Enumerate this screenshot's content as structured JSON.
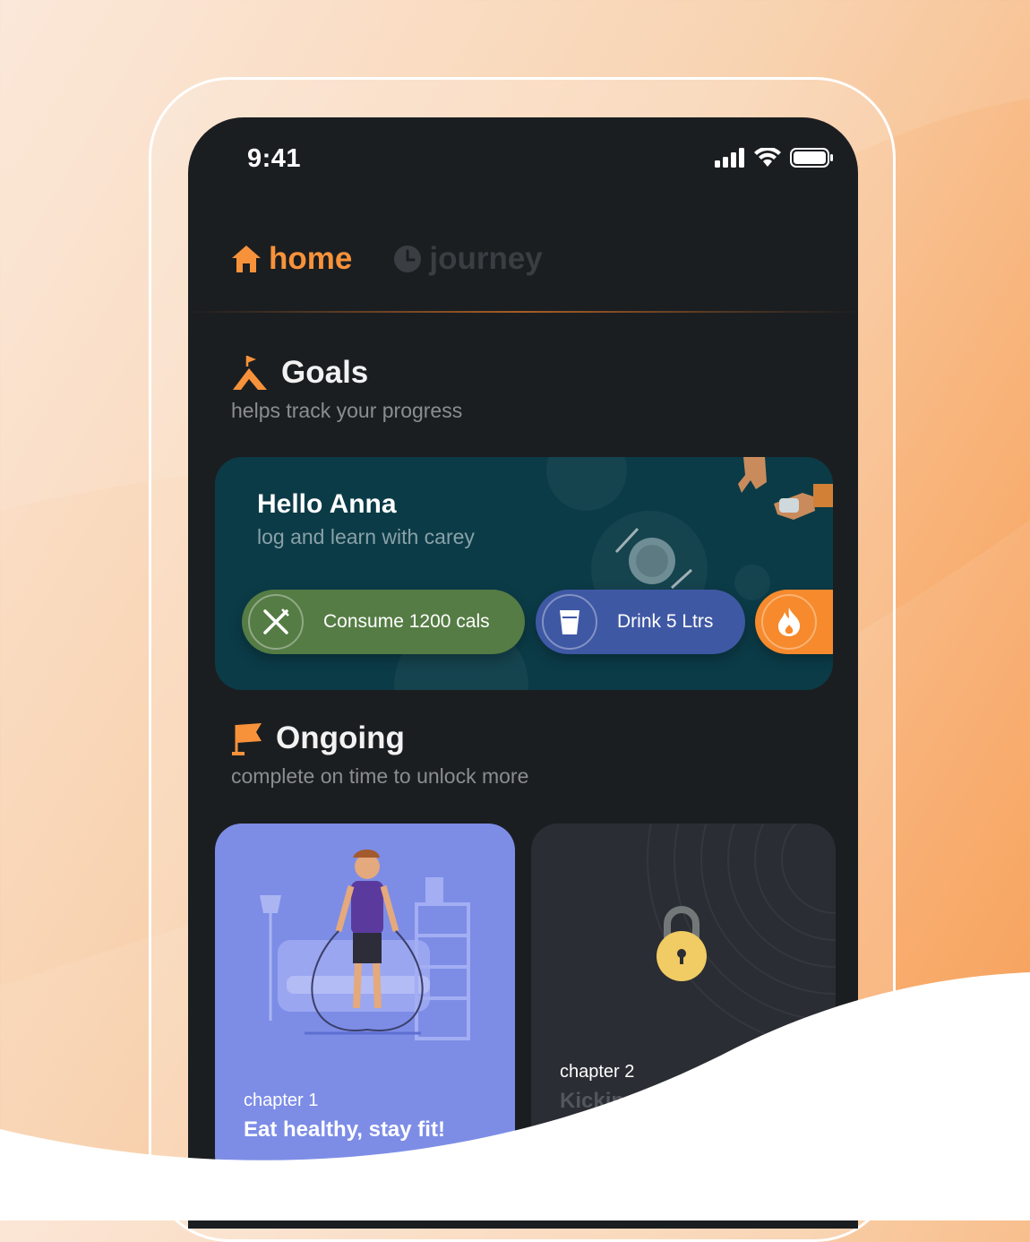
{
  "status_bar": {
    "time": "9:41"
  },
  "tabs": [
    {
      "label": "home",
      "icon": "house-icon",
      "active": true
    },
    {
      "label": "journey",
      "icon": "clock-icon",
      "active": false
    }
  ],
  "goals": {
    "title": "Goals",
    "subtitle": "helps track your progress",
    "greeting": "Hello Anna",
    "greeting_sub": "log and learn with carey",
    "pills": [
      {
        "label": "Consume 1200 cals",
        "icon": "fork-knife-icon",
        "color": "#557c44"
      },
      {
        "label": "Drink 5 Ltrs",
        "icon": "cup-icon",
        "color": "#3f58a4"
      },
      {
        "label": "",
        "icon": "flame-icon",
        "color": "#f68a2c"
      }
    ]
  },
  "ongoing": {
    "title": "Ongoing",
    "subtitle": "complete on time to unlock more",
    "chapters": [
      {
        "label": "chapter 1",
        "title": "Eat healthy, stay fit!",
        "locked": false
      },
      {
        "label": "chapter 2",
        "title": "Kickin",
        "locked": true
      }
    ]
  },
  "colors": {
    "accent": "#f8923a",
    "screen_bg": "#1b1e21",
    "goal_card_bg": "#0b3b47",
    "chapter1_bg": "#7d8de6",
    "chapter2_bg": "#2a2d33",
    "lock": "#f1cb63"
  }
}
